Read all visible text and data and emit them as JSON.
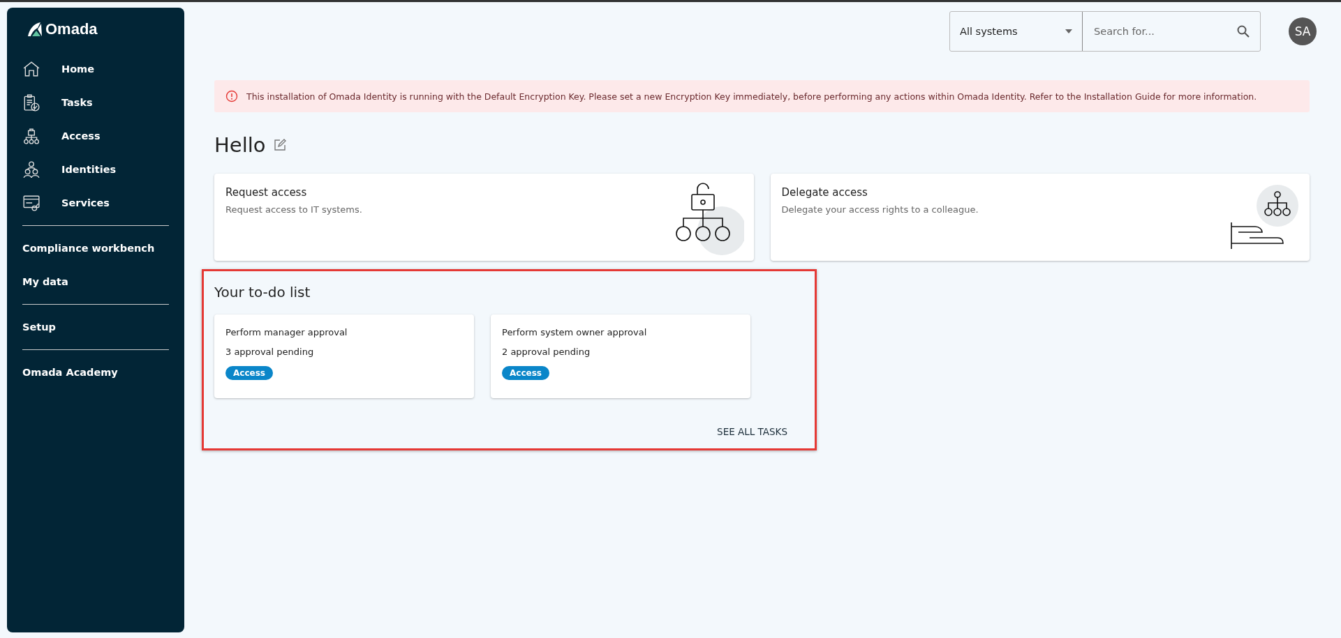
{
  "sidebar": {
    "logo": "Omada",
    "groups": [
      [
        {
          "label": "Home"
        },
        {
          "label": "Tasks"
        },
        {
          "label": "Access"
        },
        {
          "label": "Identities"
        },
        {
          "label": "Services"
        }
      ],
      [
        {
          "label": "Compliance workbench"
        },
        {
          "label": "My data"
        }
      ],
      [
        {
          "label": "Setup"
        }
      ],
      [
        {
          "label": "Omada Academy"
        }
      ]
    ]
  },
  "topbar": {
    "system_select": "All systems",
    "search": {
      "placeholder": "Search for..."
    },
    "avatar": "SA"
  },
  "banner": "This installation of Omada Identity is running with the Default Encryption Key. Please set a new Encryption Key immediately, before performing any actions within Omada Identity. Refer to the Installation Guide for more information.",
  "greeting": "Hello",
  "action_cards": [
    {
      "title": "Request access",
      "description": "Request access to IT systems."
    },
    {
      "title": "Delegate access",
      "description": "Delegate your access rights to a colleague."
    }
  ],
  "todo": {
    "title": "Your to-do list",
    "tasks": [
      {
        "title": "Perform manager approval",
        "count": "3 approval pending",
        "tag": "Access"
      },
      {
        "title": "Perform system owner approval",
        "count": "2 approval pending",
        "tag": "Access"
      }
    ],
    "see_all": "SEE ALL TASKS"
  }
}
